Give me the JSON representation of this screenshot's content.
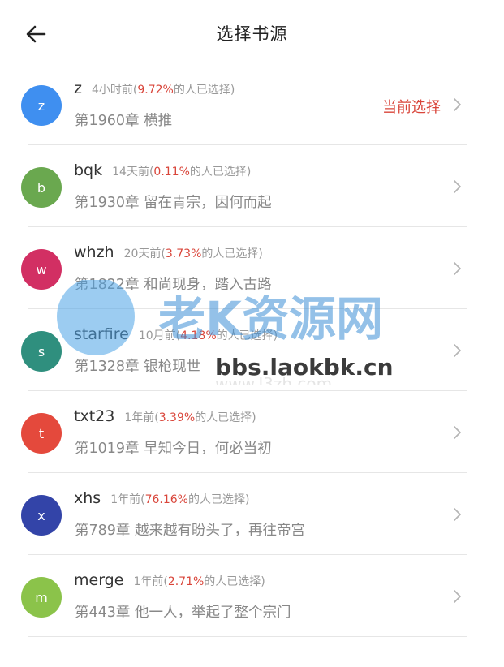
{
  "header": {
    "title": "选择书源"
  },
  "sources": [
    {
      "letter": "z",
      "name": "z",
      "time": "4小时前(",
      "pct": "9.72%",
      "suffix": "的人已选择)",
      "chapter": "第1960章 横推",
      "current": "当前选择",
      "color": "#3f8ff0"
    },
    {
      "letter": "b",
      "name": "bqk",
      "time": "14天前(",
      "pct": "0.11%",
      "suffix": "的人已选择)",
      "chapter": "第1930章 留在青宗，因何而起",
      "color": "#6aa84f"
    },
    {
      "letter": "w",
      "name": "whzh",
      "time": "20天前(",
      "pct": "3.73%",
      "suffix": "的人已选择)",
      "chapter": "第1822章 和尚现身，踏入古路",
      "color": "#d22f63"
    },
    {
      "letter": "s",
      "name": "starfire",
      "time": "10月前(",
      "pct": "4.18%",
      "suffix": "的人已选择)",
      "chapter": "第1328章 银枪现世",
      "color": "#2f8f7e"
    },
    {
      "letter": "t",
      "name": "txt23",
      "time": "1年前(",
      "pct": "3.39%",
      "suffix": "的人已选择)",
      "chapter": "第1019章 早知今日，何必当初",
      "color": "#e4493c"
    },
    {
      "letter": "x",
      "name": "xhs",
      "time": "1年前(",
      "pct": "76.16%",
      "suffix": "的人已选择)",
      "chapter": "第789章 越来越有盼头了，再往帝宫",
      "color": "#3344a8"
    },
    {
      "letter": "m",
      "name": "merge",
      "time": "1年前(",
      "pct": "2.71%",
      "suffix": "的人已选择)",
      "chapter": "第443章 他一人，举起了整个宗门",
      "color": "#8bc34a"
    }
  ],
  "watermark": {
    "brand": "老K资源网",
    "url": "bbs.laokbk.cn",
    "url2": "www.l3zh.com"
  },
  "icons": {
    "back": "arrow-left-icon",
    "chevron": "chevron-right-icon"
  }
}
